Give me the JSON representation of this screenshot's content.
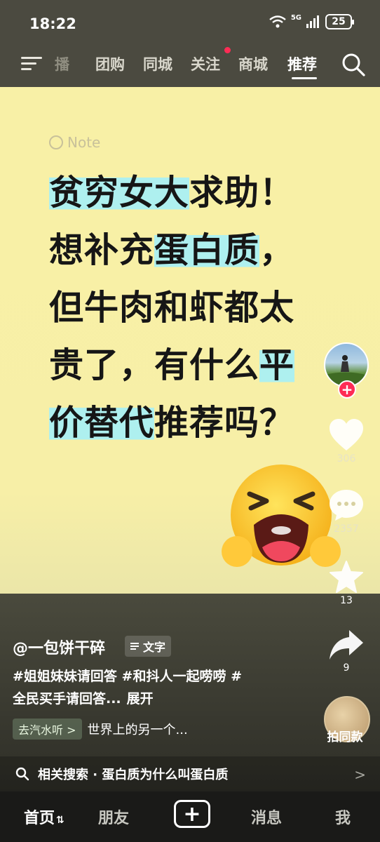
{
  "status_bar": {
    "time": "18:22",
    "network": "5G",
    "battery": "25"
  },
  "top_nav": {
    "tabs": [
      {
        "label": "播",
        "state": "faded"
      },
      {
        "label": "团购",
        "state": "normal"
      },
      {
        "label": "同城",
        "state": "normal"
      },
      {
        "label": "关注",
        "state": "normal"
      },
      {
        "label": "商城",
        "state": "normal"
      },
      {
        "label": "推荐",
        "state": "active"
      }
    ]
  },
  "poster": {
    "note_label": "Note",
    "headline": [
      {
        "text": "贫穷女大",
        "hl": true
      },
      {
        "text": "求助！",
        "hl": false
      },
      {
        "text": "想补充",
        "hl": false
      },
      {
        "text": "蛋白质",
        "hl": true
      },
      {
        "text": "，",
        "hl": false
      },
      {
        "text": "但牛肉和虾都太",
        "hl": false
      },
      {
        "text": "贵了，有什么",
        "hl": false
      },
      {
        "text": "平",
        "hl": true
      },
      {
        "text": "价替代",
        "hl": true
      },
      {
        "text": "推荐吗？",
        "hl": false
      }
    ]
  },
  "rail": {
    "like_count": "306",
    "comment_count": "2357",
    "favorite_count": "13",
    "share_count": "9",
    "same_style_label": "拍同款"
  },
  "info": {
    "author": "@一包饼干碎",
    "text_tag": "文字",
    "desc_line1": "#姐姐妹妹请回答 #和抖人一起唠唠 #",
    "desc_line2": "全民买手请回答...",
    "expand": "展开",
    "music_chip": "去汽水听 >",
    "music_title": "世界上的另一个...",
    "related_search": "相关搜索 · 蛋白质为什么叫蛋白质",
    "related_arrow": ">"
  },
  "tabbar": {
    "home": "首页",
    "home_swap": "⇅",
    "friends": "朋友",
    "plus": "+",
    "messages": "消息",
    "me": "我"
  },
  "colors": {
    "highlight": "#aef0ef",
    "poster_bg": "#f8f0a6",
    "accent_red": "#fe2c55"
  }
}
